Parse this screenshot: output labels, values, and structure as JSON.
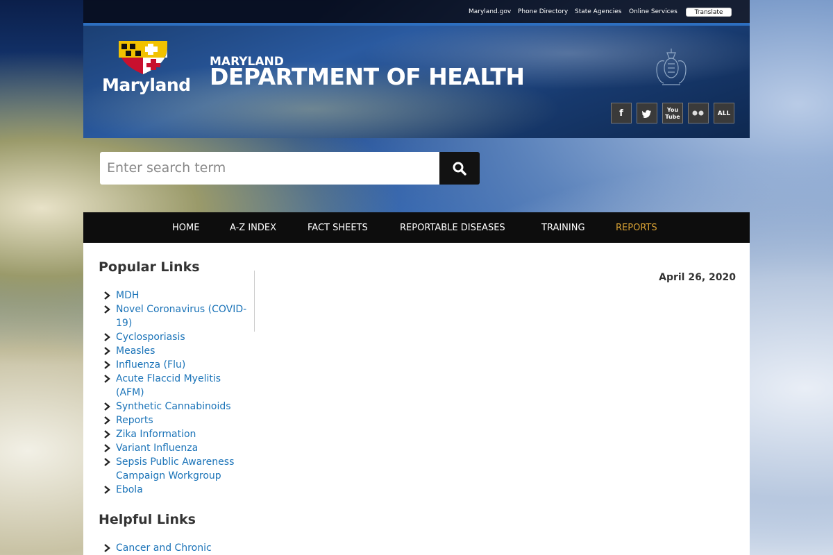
{
  "utility": {
    "links": [
      "Maryland.gov",
      "Phone Directory",
      "State Agencies",
      "Online Services"
    ],
    "translate_label": "Translate"
  },
  "header": {
    "logo_text": "Maryland",
    "dept_top": "MARYLAND",
    "dept_main": "DEPARTMENT OF HEALTH",
    "seal_icon": "state-seal-icon",
    "social": [
      {
        "name": "facebook",
        "icon": "facebook-icon",
        "label": "f"
      },
      {
        "name": "twitter",
        "icon": "twitter-icon",
        "label": ""
      },
      {
        "name": "youtube",
        "icon": "youtube-icon",
        "label": "You Tube"
      },
      {
        "name": "flickr",
        "icon": "flickr-icon",
        "label": ""
      },
      {
        "name": "all",
        "icon": "all-icon",
        "label": "ALL"
      }
    ]
  },
  "search": {
    "placeholder": "Enter search term",
    "button_icon": "search-icon"
  },
  "nav": {
    "items": [
      "HOME",
      "A-Z INDEX",
      "FACT SHEETS",
      "REPORTABLE DISEASES",
      "TRAINING",
      "REPORTS"
    ],
    "active": "REPORTS",
    "active_color": "#d9a234"
  },
  "main": {
    "date": "April 26, 2020"
  },
  "popular": {
    "title": "Popular Links",
    "items": [
      "MDH",
      "Novel Coronavirus (COVID-19)",
      "Cyclosporiasis",
      "Measles",
      "Influenza (Flu)",
      "Acute Flaccid Myelitis (AFM)",
      "Synthetic Cannabinoids",
      "Reports",
      "Zika Information",
      "Variant Influenza",
      "Sepsis Public Awareness Campaign Workgroup",
      "Ebola"
    ]
  },
  "helpful": {
    "title": "Helpful Links",
    "items": [
      "Cancer and Chronic"
    ]
  },
  "colors": {
    "link": "#1a73b8",
    "nav_bg": "#0d0d0d",
    "accent_blue": "#2d6fc0"
  }
}
